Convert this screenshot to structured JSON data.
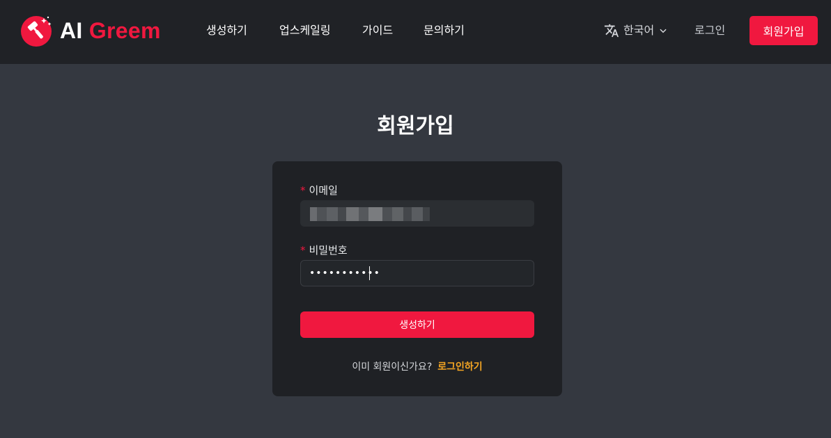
{
  "brand": {
    "ai": "AI",
    "greem": "Greem",
    "accent": "#f0183f",
    "icon": "paint-roller-logo-icon"
  },
  "nav": {
    "items": [
      "생성하기",
      "업스케일링",
      "가이드",
      "문의하기"
    ],
    "language": "한국어",
    "login": "로그인",
    "signup": "회원가입"
  },
  "form": {
    "title": "회원가입",
    "email_label": "이메일",
    "required_mark": "*",
    "password_label": "비밀번호",
    "password_value": "•••••••••••",
    "submit_label": "생성하기",
    "already_member": "이미 회원이신가요?",
    "login_link": "로그인하기"
  },
  "colors": {
    "header_bg": "#202226",
    "page_bg": "#343840",
    "card_bg": "#1f2125",
    "link": "#f5a623"
  }
}
